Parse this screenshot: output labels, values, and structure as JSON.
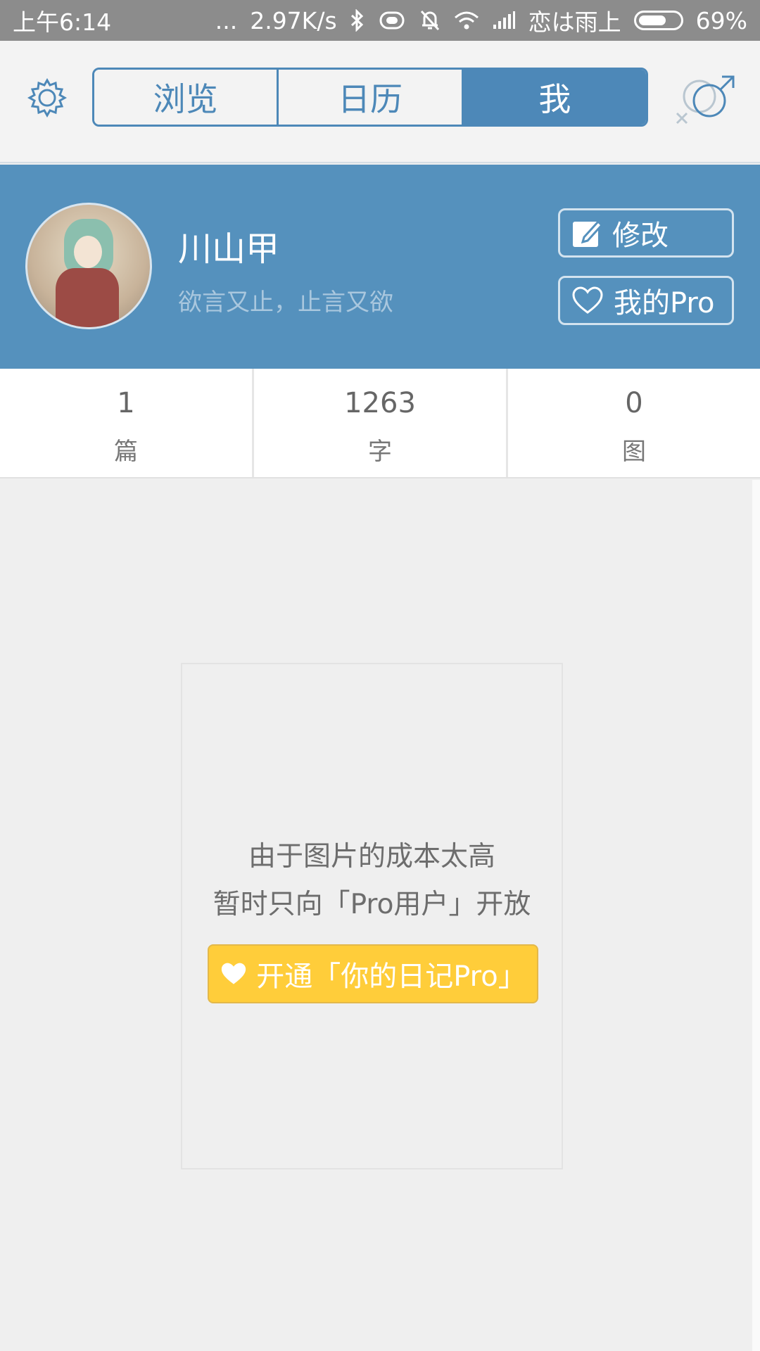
{
  "status_bar": {
    "time": "上午6:14",
    "dots": "...",
    "speed": "2.97K/s",
    "carrier": "恋は雨上",
    "battery": "69%",
    "battery_level": 0.69
  },
  "nav": {
    "tabs": [
      {
        "label": "浏览",
        "active": false
      },
      {
        "label": "日历",
        "active": false
      },
      {
        "label": "我",
        "active": true
      }
    ]
  },
  "profile": {
    "name": "川山甲",
    "signature": "欲言又止，止言又欲",
    "edit_label": "修改",
    "pro_label": "我的Pro"
  },
  "stats": [
    {
      "value": "1",
      "label": "篇"
    },
    {
      "value": "1263",
      "label": "字"
    },
    {
      "value": "0",
      "label": "图"
    }
  ],
  "promo": {
    "line1": "由于图片的成本太高",
    "line2": "暂时只向「Pro用户」开放",
    "button_label": "开通「你的日记Pro」"
  },
  "colors": {
    "accent": "#4d88b8",
    "profile_bg": "#5591bd",
    "pro_button": "#ffcd3a"
  }
}
